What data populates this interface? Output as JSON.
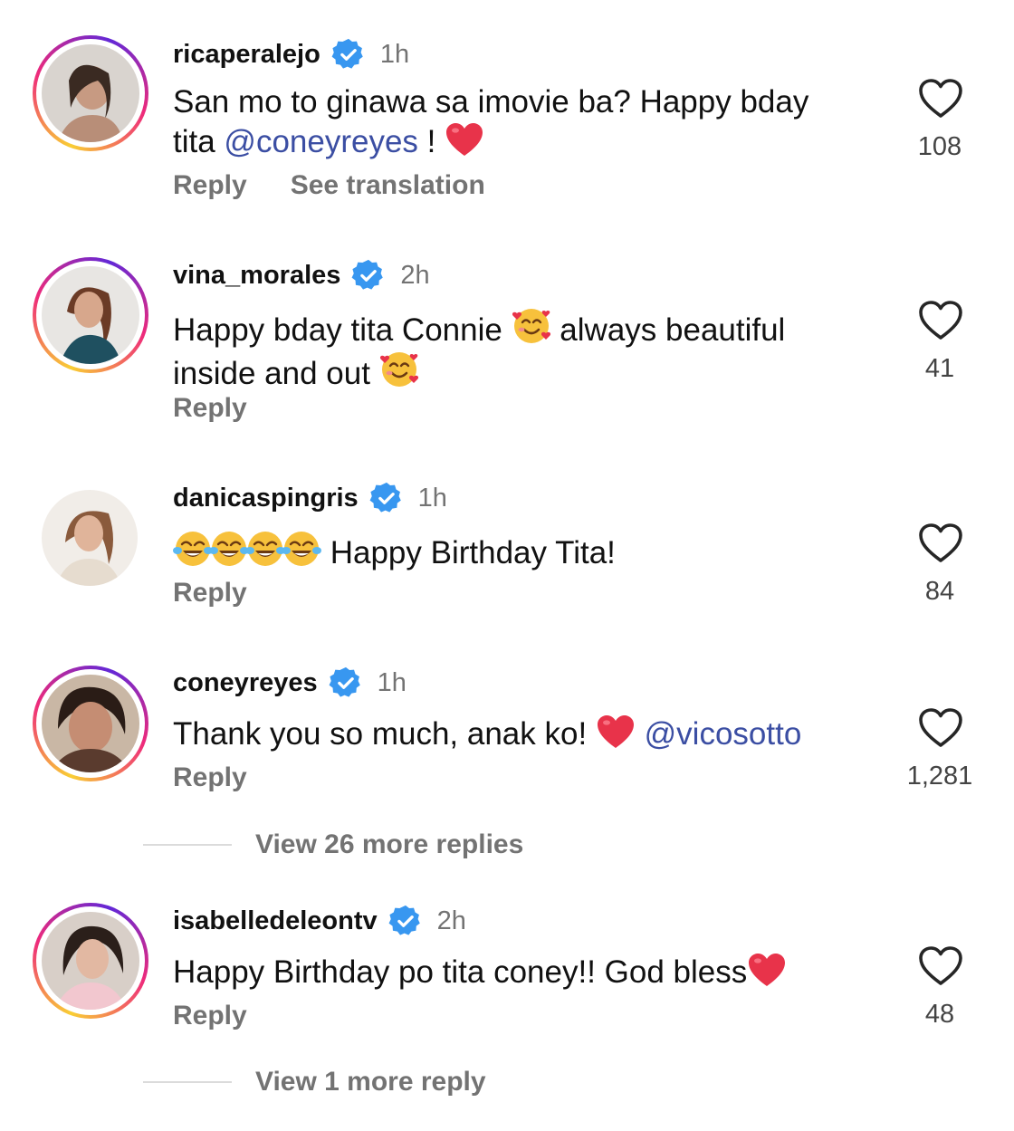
{
  "comments": [
    {
      "username": "ricaperalejo",
      "time": "1h",
      "text_parts": [
        "San mo to ginawa sa imovie ba? Happy bday",
        "tita ",
        "@coneyreyes",
        " !"
      ],
      "reply_label": "Reply",
      "translate_label": "See translation",
      "likes": "108"
    },
    {
      "username": "vina_morales",
      "time": "2h",
      "text_parts": [
        "Happy bday tita Connie ",
        " always beautiful",
        "inside and out "
      ],
      "reply_label": "Reply",
      "likes": "41"
    },
    {
      "username": "danicaspingris",
      "time": "1h",
      "text_parts": [
        " Happy Birthday Tita!"
      ],
      "reply_label": "Reply",
      "likes": "84"
    },
    {
      "username": "coneyreyes",
      "time": "1h",
      "text_parts": [
        "Thank you so much, anak ko! ",
        "@vicosotto"
      ],
      "reply_label": "Reply",
      "likes": "1,281",
      "view_replies": "View 26 more replies"
    },
    {
      "username": "isabelledeleontv",
      "time": "2h",
      "text_parts": [
        "Happy Birthday po tita coney!! God bless"
      ],
      "reply_label": "Reply",
      "likes": "48",
      "view_replies": "View 1 more reply"
    }
  ],
  "icons": {
    "verified": "verified-badge-icon",
    "like": "heart-outline-icon",
    "heart_emoji": "red-heart-emoji",
    "smiling_hearts_emoji": "smiling-face-with-hearts-emoji",
    "tears_of_joy_emoji": "face-with-tears-of-joy-emoji"
  },
  "colors": {
    "mention": "#3b4ea3",
    "verified": "#3897f0",
    "secondary_text": "#737373",
    "story_ring": "#ee2a7b"
  }
}
